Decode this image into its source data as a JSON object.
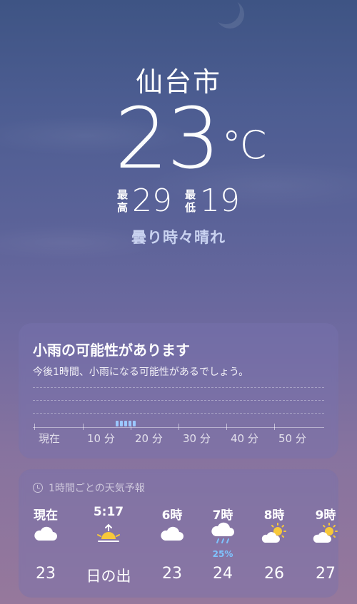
{
  "location": {
    "city": "仙台市",
    "temperature": "23",
    "unit": "°C",
    "high_label_top": "最",
    "high_label_bottom": "高",
    "high": "29",
    "low_label_top": "最",
    "low_label_bottom": "低",
    "low": "19",
    "condition": "曇り時々晴れ"
  },
  "rain_card": {
    "title": "小雨の可能性があります",
    "subtitle": "今後1時間、小雨になる可能性があるでしょう。",
    "axis_labels": [
      "現在",
      "10 分",
      "20 分",
      "30 分",
      "40 分",
      "50 分"
    ]
  },
  "hourly": {
    "header": "1時間ごとの天気予報",
    "items": [
      {
        "time": "現在",
        "icon": "cloud-icon",
        "temp": "23",
        "precip": ""
      },
      {
        "time": "5:17",
        "icon": "sunrise-icon",
        "temp": "日の出",
        "precip": ""
      },
      {
        "time": "6時",
        "icon": "cloud-icon",
        "temp": "23",
        "precip": ""
      },
      {
        "time": "7時",
        "icon": "cloud-rain-icon",
        "temp": "24",
        "precip": "25%"
      },
      {
        "time": "8時",
        "icon": "partly-cloudy-icon",
        "temp": "26",
        "precip": ""
      },
      {
        "time": "9時",
        "icon": "partly-cloudy-icon",
        "temp": "27",
        "precip": ""
      }
    ]
  },
  "colors": {
    "rain_accent": "#7fc4ff",
    "sun": "#f7c83a"
  }
}
